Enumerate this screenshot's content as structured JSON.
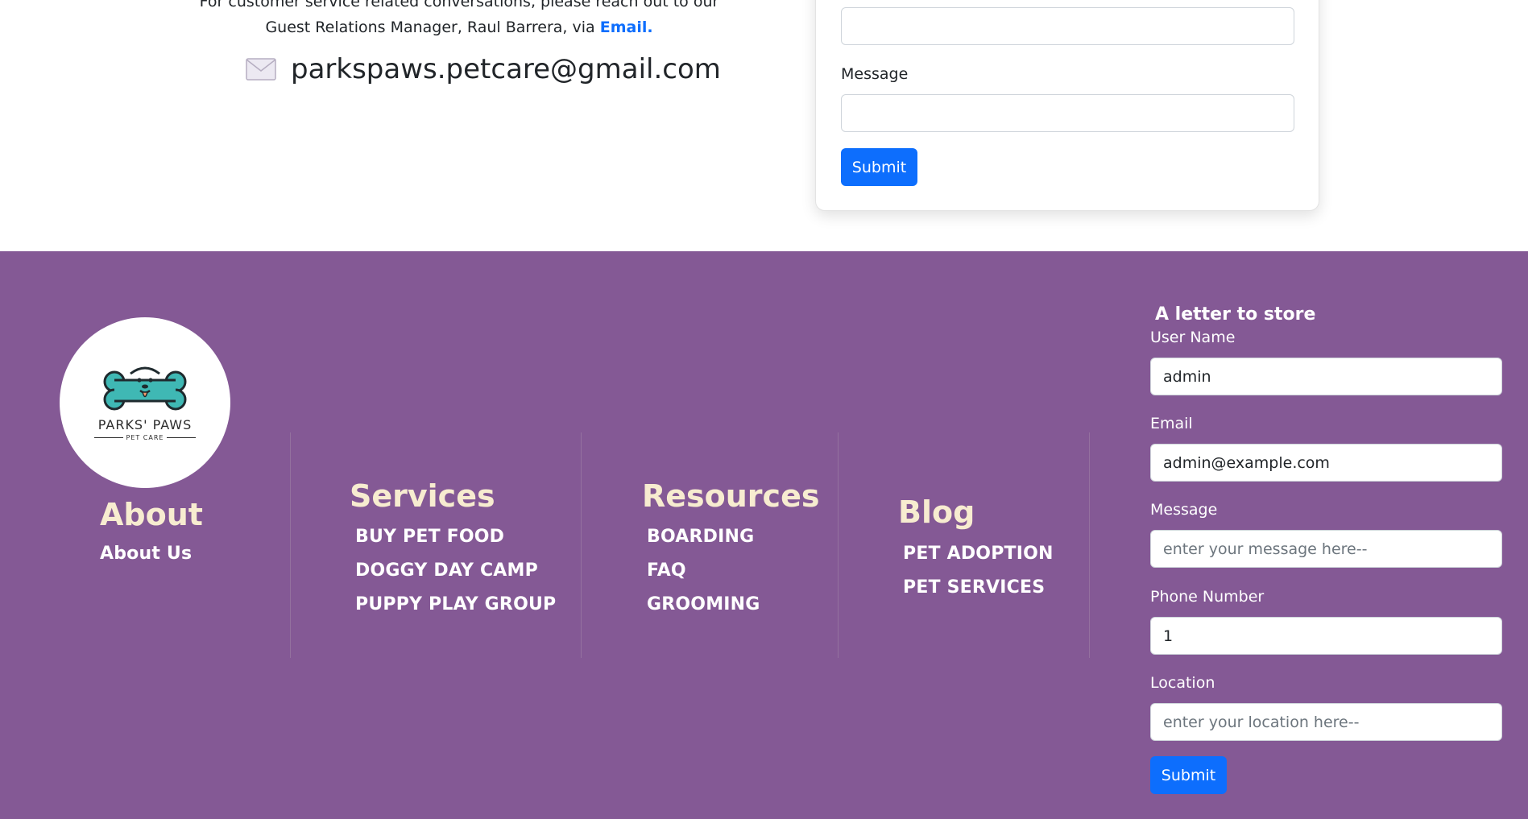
{
  "contact": {
    "text_line1": "For customer service related conversations, please reach out to our",
    "text_line2": "Guest Relations Manager, Raul Barrera, via",
    "email_link": "Email.",
    "email_address": "parkspaws.petcare@gmail.com",
    "mail_icon": "envelope-icon"
  },
  "contact_form": {
    "message_label": "Message",
    "submit_label": "Submit"
  },
  "footer": {
    "background_color": "#845995",
    "heading_color": "#f7ecd0",
    "logo": {
      "title": "PARKS' PAWS",
      "subtitle": "PET CARE",
      "icon": "dog-bone-logo-icon"
    },
    "about": {
      "heading": "About",
      "links": [
        "About Us"
      ]
    },
    "services": {
      "heading": "Services",
      "links": [
        "BUY PET FOOD",
        "DOGGY DAY CAMP",
        "PUPPY PLAY GROUP"
      ]
    },
    "resources": {
      "heading": "Resources",
      "links": [
        "BOARDING",
        "FAQ",
        "GROOMING"
      ]
    },
    "blog": {
      "heading": "Blog",
      "links": [
        "PET ADOPTION",
        "PET SERVICES"
      ]
    }
  },
  "letter_form": {
    "title": "A letter to store",
    "username_label": "User Name",
    "username_value": "admin",
    "email_label": "Email",
    "email_value": "admin@example.com",
    "message_label": "Message",
    "message_placeholder": "enter your message here--",
    "phone_label": "Phone Number",
    "phone_value": "1",
    "location_label": "Location",
    "location_placeholder": "enter your location here--",
    "submit_label": "Submit"
  },
  "accent_color": "#0d6efd"
}
